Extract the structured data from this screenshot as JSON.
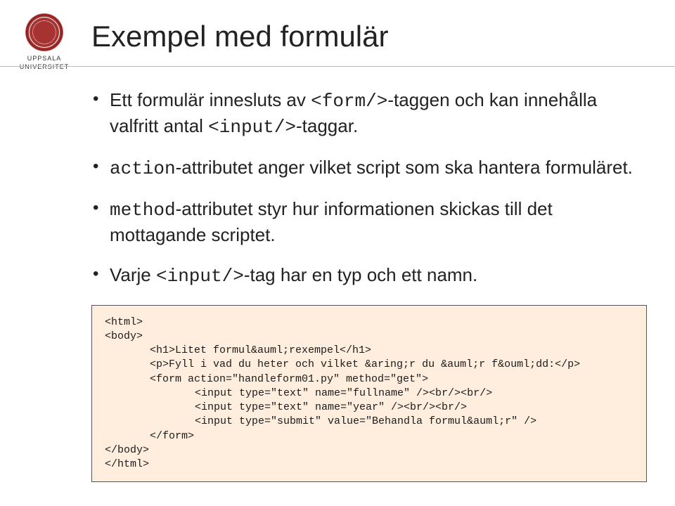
{
  "logo": {
    "line1": "UPPSALA",
    "line2": "UNIVERSITET"
  },
  "title": "Exempel med formulär",
  "bullets": [
    {
      "pre": "Ett formulär innesluts av ",
      "code1": "<form/>",
      "mid1": "-taggen och kan innehålla valfritt antal ",
      "code2": "<input/>",
      "post": "-taggar."
    },
    {
      "code1": "action",
      "post": "-attributet anger vilket script som ska hantera formuläret."
    },
    {
      "code1": "method",
      "post": "-attributet styr hur informationen skickas till det mottagande scriptet."
    },
    {
      "pre": "Varje ",
      "code1": "<input/>",
      "post": "-tag har en typ och ett namn."
    }
  ],
  "code": {
    "l1": "<html>",
    "l2": "<body>",
    "l3": "<h1>Litet formul&auml;rexempel</h1>",
    "l4": "<p>Fyll i vad du heter och vilket &aring;r du &auml;r f&ouml;dd:</p>",
    "l5": "<form action=\"handleform01.py\" method=\"get\">",
    "l6": "<input type=\"text\" name=\"fullname\" /><br/><br/>",
    "l7": "<input type=\"text\" name=\"year\" /><br/><br/>",
    "l8": "<input type=\"submit\" value=\"Behandla formul&auml;r\" />",
    "l9": "</form>",
    "l10": "</body>",
    "l11": "</html>"
  }
}
